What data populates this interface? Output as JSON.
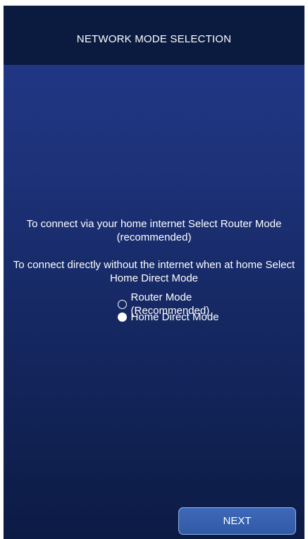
{
  "header": {
    "title": "NETWORK MODE SELECTION"
  },
  "content": {
    "router_instruction": "To connect via your home internet Select Router Mode (recommended)",
    "direct_instruction": "To connect directly without the internet when at home Select Home Direct Mode"
  },
  "options": [
    {
      "label": "Router Mode (Recommended)",
      "selected": false
    },
    {
      "label": "Home Direct Mode",
      "selected": true
    }
  ],
  "footer": {
    "next_label": "NEXT"
  },
  "colors": {
    "header_bg": "#0b1a3f",
    "background_top": "#24398a",
    "background_bottom": "#0c1b44",
    "button_bg": "#3e69b8",
    "button_border": "#8fb0e6",
    "text": "#ffffff"
  }
}
